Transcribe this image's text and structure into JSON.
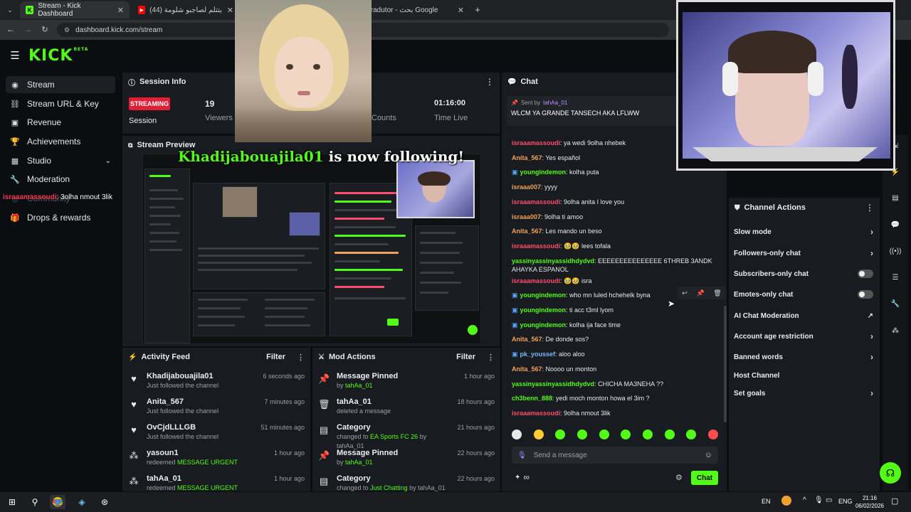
{
  "browser": {
    "tabs": [
      {
        "title": "Stream - Kick Dashboard",
        "active": true
      },
      {
        "title": "(44) دجنا يتتلم لصاجبو شلومة",
        "active": false
      },
      {
        "title": "tradutor - بحث Google",
        "active": false
      }
    ],
    "url": "dashboard.kick.com/stream"
  },
  "brand": {
    "logo": "KICK",
    "beta": "BETA",
    "accent": "#53fc18"
  },
  "sidebar": {
    "items": [
      {
        "label": "Stream",
        "icon": "stream-icon"
      },
      {
        "label": "Stream URL & Key",
        "icon": "link-icon"
      },
      {
        "label": "Revenue",
        "icon": "revenue-icon"
      },
      {
        "label": "Achievements",
        "icon": "trophy-icon"
      },
      {
        "label": "Studio",
        "icon": "studio-icon"
      },
      {
        "label": "Moderation",
        "icon": "wrench-icon"
      },
      {
        "label": "Community",
        "icon": "community-icon"
      },
      {
        "label": "Drops & rewards",
        "icon": "gift-icon"
      }
    ],
    "overlay_user": "israaamassoudi",
    "overlay_msg": "3olha nmout 3lik"
  },
  "session": {
    "title": "Session Info",
    "status": "STREAMING",
    "status_label": "Session",
    "viewers": "19",
    "viewers_label": "Viewers",
    "counts_label": "Counts",
    "time": "01:16:00",
    "time_label": "Time Live"
  },
  "preview": {
    "title": "Stream Preview",
    "follow_user": "Khadijabouajila01",
    "follow_text": " is now following!"
  },
  "activity": {
    "title": "Activity Feed",
    "filter": "Filter",
    "items": [
      {
        "user": "Khadijabouajila01",
        "desc": "Just followed the channel",
        "time": "6 seconds ago",
        "icon": "heart-icon",
        "highlight": ""
      },
      {
        "user": "Anita_567",
        "desc": "Just followed the channel",
        "time": "7 minutes ago",
        "icon": "heart-icon",
        "highlight": ""
      },
      {
        "user": "OvCjdLLLGB",
        "desc": "Just followed the channel",
        "time": "51 minutes ago",
        "icon": "heart-icon",
        "highlight": ""
      },
      {
        "user": "yasoun1",
        "desc": "redeemed ",
        "time": "1 hour ago",
        "icon": "reward-icon",
        "highlight": "MESSAGE URGENT"
      },
      {
        "user": "tahAa_01",
        "desc": "redeemed ",
        "time": "1 hour ago",
        "icon": "reward-icon",
        "highlight": "MESSAGE URGENT"
      }
    ]
  },
  "modactions": {
    "title": "Mod Actions",
    "filter": "Filter",
    "items": [
      {
        "title": "Message Pinned",
        "pre": "by ",
        "user": "tahAa_01",
        "post": "",
        "time": "1 hour ago",
        "icon": "pin-icon"
      },
      {
        "title": "tahAa_01",
        "pre": "deleted a message",
        "user": "",
        "post": "",
        "time": "18 hours ago",
        "icon": "trash-icon"
      },
      {
        "title": "Category",
        "pre": "changed to ",
        "user": "EA Sports FC 26",
        "post": " by tahAa_01",
        "time": "21 hours ago",
        "icon": "category-icon"
      },
      {
        "title": "Message Pinned",
        "pre": "by ",
        "user": "tahAa_01",
        "post": "",
        "time": "22 hours ago",
        "icon": "pin-icon"
      },
      {
        "title": "Category",
        "pre": "changed to ",
        "user": "Just Chatting",
        "post": " by tahAa_01",
        "time": "22 hours ago",
        "icon": "category-icon"
      }
    ]
  },
  "chat": {
    "title": "Chat",
    "pinned_sender_label": "Sent by",
    "pinned_sender": "tahAa_01",
    "pinned_text": "WLCM YA GRANDE TANSECH AKA LFLWW",
    "messages": [
      {
        "user": "israaamassoudi",
        "text": ": ya wedi 9olha nhebek",
        "cls": "u1",
        "badge": false
      },
      {
        "user": "Anita_567",
        "text": ": Yes español",
        "cls": "u2",
        "badge": false
      },
      {
        "user": "youngindemon",
        "text": ": kolha puta",
        "cls": "u3",
        "badge": true
      },
      {
        "user": "israaa007",
        "text": ": yyyy",
        "cls": "u2",
        "badge": false
      },
      {
        "user": "israaamassoudi",
        "text": ": 9olha anita I love you",
        "cls": "u1",
        "badge": false
      },
      {
        "user": "israaa007",
        "text": ": 9olha ti amoo",
        "cls": "u2",
        "badge": false
      },
      {
        "user": "Anita_567",
        "text": ": Les mando un beso",
        "cls": "u2",
        "badge": false
      },
      {
        "user": "israaamassoudi",
        "text": ": 🥹🥹 lees tofala",
        "cls": "u1",
        "badge": false
      },
      {
        "user": "yassinyassinyassidhdydvd",
        "text": ": EEEEEEEEEEEEEEE 6THREB 3ANDK AHAYKA ESPANOL",
        "cls": "u3",
        "badge": false
      },
      {
        "user": "israaamassoudi",
        "text": ": 🥹🥹 isra",
        "cls": "u1",
        "badge": false
      },
      {
        "user": "youngindemon",
        "text": ": who mn luled hchehelk byna",
        "cls": "u3",
        "badge": true
      },
      {
        "user": "youngindemon",
        "text": ": ti acc t3ml lyom",
        "cls": "u3",
        "badge": true
      },
      {
        "user": "youngindemon",
        "text": ": kolha ija face time",
        "cls": "u3",
        "badge": true
      },
      {
        "user": "Anita_567",
        "text": ": De donde sos?",
        "cls": "u2",
        "badge": false
      },
      {
        "user": "pk_youssef",
        "text": ": aloo aloo",
        "cls": "u4",
        "badge": true
      },
      {
        "user": "Anita_567",
        "text": ": Noooo un monton",
        "cls": "u2",
        "badge": false
      },
      {
        "user": "yassinyassinyassidhdydvd",
        "text": ": CHICHA MA3NEHA ??",
        "cls": "u3",
        "badge": false
      },
      {
        "user": "ch3benn_888",
        "text": ": yedi moch monton howa el 3im ?",
        "cls": "u3",
        "badge": false
      },
      {
        "user": "israaamassoudi",
        "text": ": 9olha nmout 3lik",
        "cls": "u1",
        "badge": false
      }
    ],
    "input_placeholder": "Send a message",
    "send_label": "Chat",
    "infinity": "∞"
  },
  "channel_actions": {
    "title": "Channel Actions",
    "items": [
      {
        "label": "Slow mode",
        "control": "chevron"
      },
      {
        "label": "Followers-only chat",
        "control": "chevron"
      },
      {
        "label": "Subscribers-only chat",
        "control": "toggle"
      },
      {
        "label": "Emotes-only chat",
        "control": "toggle"
      },
      {
        "label": "AI Chat Moderation",
        "control": "external"
      },
      {
        "label": "Account age restriction",
        "control": "chevron"
      },
      {
        "label": "Banned words",
        "control": "chevron"
      },
      {
        "label": "Host Channel",
        "control": "none"
      },
      {
        "label": "Set goals",
        "control": "chevron"
      }
    ]
  },
  "taskbar": {
    "lang1": "EN",
    "lang2": "ENG",
    "time": "21:16",
    "date": "06/02/2026"
  }
}
